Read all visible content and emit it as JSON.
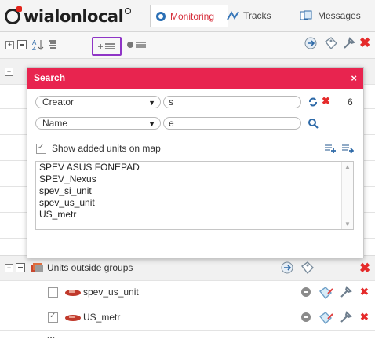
{
  "app": {
    "logo_text": "wialonlocal"
  },
  "tabs": [
    {
      "label": "Monitoring",
      "active": true
    },
    {
      "label": "Tracks",
      "active": false
    },
    {
      "label": "Messages",
      "active": false
    }
  ],
  "search_dialog": {
    "title": "Search",
    "close": "×",
    "filter1": {
      "property": "Creator",
      "value": "s",
      "count": "6"
    },
    "filter2": {
      "property": "Name",
      "value": "e"
    },
    "show_on_map_label": "Show added units on map",
    "show_on_map_checked": true,
    "results": [
      "SPEV ASUS FONEPAD",
      "SPEV_Nexus",
      "spev_si_unit",
      "spev_us_unit",
      "US_metr"
    ]
  },
  "list": {
    "ellipsis_top": "...",
    "group": {
      "name": "Units outside groups"
    },
    "units": [
      {
        "name": "spev_us_unit",
        "checked": false
      },
      {
        "name": "US_metr",
        "checked": true
      }
    ],
    "ellipsis_bottom": "..."
  },
  "colors": {
    "accent_red": "#e8244f",
    "selection_purple": "#8f35c6",
    "active_tab_text": "#d62d3a"
  }
}
